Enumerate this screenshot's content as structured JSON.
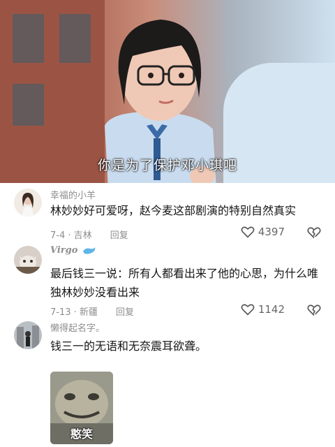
{
  "video": {
    "subtitle": "你是为了保护邓小琪吧"
  },
  "comments": [
    {
      "username": "幸福的小羊",
      "text": "林妙妙好可爱呀，赵今麦这部剧演的特别自然真实",
      "date_location": "7-4 · 吉林",
      "reply_label": "回复",
      "likes": "4397"
    },
    {
      "username": "Virgo",
      "text": "最后钱三一说：所有人都看出来了他的心思，为什么唯独林妙妙没看出来",
      "date_location": "7-13 · 新疆",
      "reply_label": "回复",
      "likes": "1142"
    },
    {
      "username": "懒得起名字。",
      "text": "钱三一的无语和无奈震耳欲聋。",
      "sticker_caption": "憨笑"
    }
  ]
}
